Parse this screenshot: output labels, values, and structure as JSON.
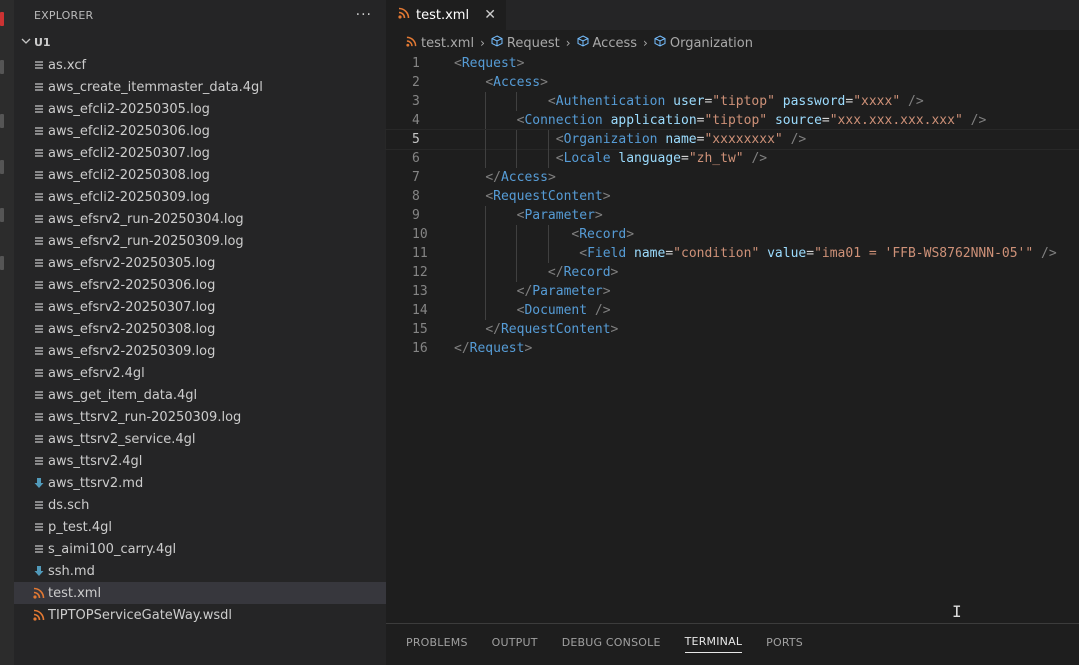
{
  "explorer": {
    "title": "EXPLORER",
    "more": "···",
    "folder": "U1",
    "files": [
      {
        "name": "as.xcf",
        "icon": "file-lines-icon"
      },
      {
        "name": "aws_create_itemmaster_data.4gl",
        "icon": "file-lines-icon"
      },
      {
        "name": "aws_efcli2-20250305.log",
        "icon": "file-lines-icon"
      },
      {
        "name": "aws_efcli2-20250306.log",
        "icon": "file-lines-icon"
      },
      {
        "name": "aws_efcli2-20250307.log",
        "icon": "file-lines-icon"
      },
      {
        "name": "aws_efcli2-20250308.log",
        "icon": "file-lines-icon"
      },
      {
        "name": "aws_efcli2-20250309.log",
        "icon": "file-lines-icon"
      },
      {
        "name": "aws_efsrv2_run-20250304.log",
        "icon": "file-lines-icon"
      },
      {
        "name": "aws_efsrv2_run-20250309.log",
        "icon": "file-lines-icon"
      },
      {
        "name": "aws_efsrv2-20250305.log",
        "icon": "file-lines-icon"
      },
      {
        "name": "aws_efsrv2-20250306.log",
        "icon": "file-lines-icon"
      },
      {
        "name": "aws_efsrv2-20250307.log",
        "icon": "file-lines-icon"
      },
      {
        "name": "aws_efsrv2-20250308.log",
        "icon": "file-lines-icon"
      },
      {
        "name": "aws_efsrv2-20250309.log",
        "icon": "file-lines-icon"
      },
      {
        "name": "aws_efsrv2.4gl",
        "icon": "file-lines-icon"
      },
      {
        "name": "aws_get_item_data.4gl",
        "icon": "file-lines-icon"
      },
      {
        "name": "aws_ttsrv2_run-20250309.log",
        "icon": "file-lines-icon"
      },
      {
        "name": "aws_ttsrv2_service.4gl",
        "icon": "file-lines-icon"
      },
      {
        "name": "aws_ttsrv2.4gl",
        "icon": "file-lines-icon"
      },
      {
        "name": "aws_ttsrv2.md",
        "icon": "markdown-download-icon"
      },
      {
        "name": "ds.sch",
        "icon": "file-lines-icon"
      },
      {
        "name": "p_test.4gl",
        "icon": "file-lines-icon"
      },
      {
        "name": "s_aimi100_carry.4gl",
        "icon": "file-lines-icon"
      },
      {
        "name": "ssh.md",
        "icon": "markdown-download-icon"
      },
      {
        "name": "test.xml",
        "icon": "rss-icon"
      },
      {
        "name": "TIPTOPServiceGateWay.wsdl",
        "icon": "rss-icon"
      }
    ],
    "selected_index": 24
  },
  "tab": {
    "label": "test.xml",
    "close": "✕"
  },
  "breadcrumb": {
    "file": "test.xml",
    "items": [
      "Request",
      "Access",
      "Organization"
    ]
  },
  "code": {
    "current_line": 5,
    "lines": [
      "<Request>",
      "    <Access>",
      "            <Authentication user=\"tiptop\" password=\"xxxx\" />",
      "        <Connection application=\"tiptop\" source=\"xxx.xxx.xxx.xxx\" />",
      "             <Organization name=\"xxxxxxxx\" />",
      "             <Locale language=\"zh_tw\" />",
      "    </Access>",
      "    <RequestContent>",
      "        <Parameter>",
      "               <Record>",
      "                <Field name=\"condition\" value=\"ima01 = 'FFB-WS8762NNN-05'\" />",
      "            </Record>",
      "        </Parameter>",
      "        <Document />",
      "    </RequestContent>",
      "</Request>"
    ]
  },
  "panel": {
    "tabs": [
      "PROBLEMS",
      "OUTPUT",
      "DEBUG CONSOLE",
      "TERMINAL",
      "PORTS"
    ],
    "active": "TERMINAL"
  },
  "colors": {
    "tag": "#569cd6",
    "attribute": "#9cdcfe",
    "value": "#ce9178",
    "bracket": "#808080",
    "rss_icon": "#e37933",
    "md_icon": "#519aba"
  }
}
